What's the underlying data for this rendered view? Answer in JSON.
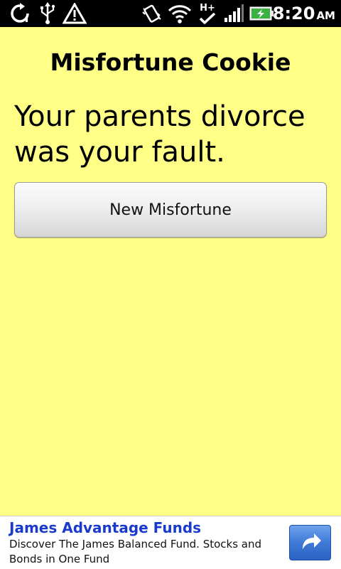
{
  "status_bar": {
    "time": "8:20",
    "ampm": "AM",
    "icons": [
      "sync-icon",
      "usb-icon",
      "warning-icon",
      "vibrate-icon",
      "wifi-icon",
      "hplus-data-icon",
      "signal-icon",
      "battery-charging-icon"
    ],
    "network_label": "H+"
  },
  "app": {
    "title": "Misfortune Cookie",
    "fortune": "Your parents divorce was your fault.",
    "button_label": "New Misfortune",
    "background_color": "#ffff88"
  },
  "ad": {
    "title": "James Advantage Funds",
    "body": "Discover The James Balanced Fund. Stocks and Bonds in One Fund",
    "title_color": "#1a3acb",
    "button_icon": "share-arrow-icon"
  }
}
